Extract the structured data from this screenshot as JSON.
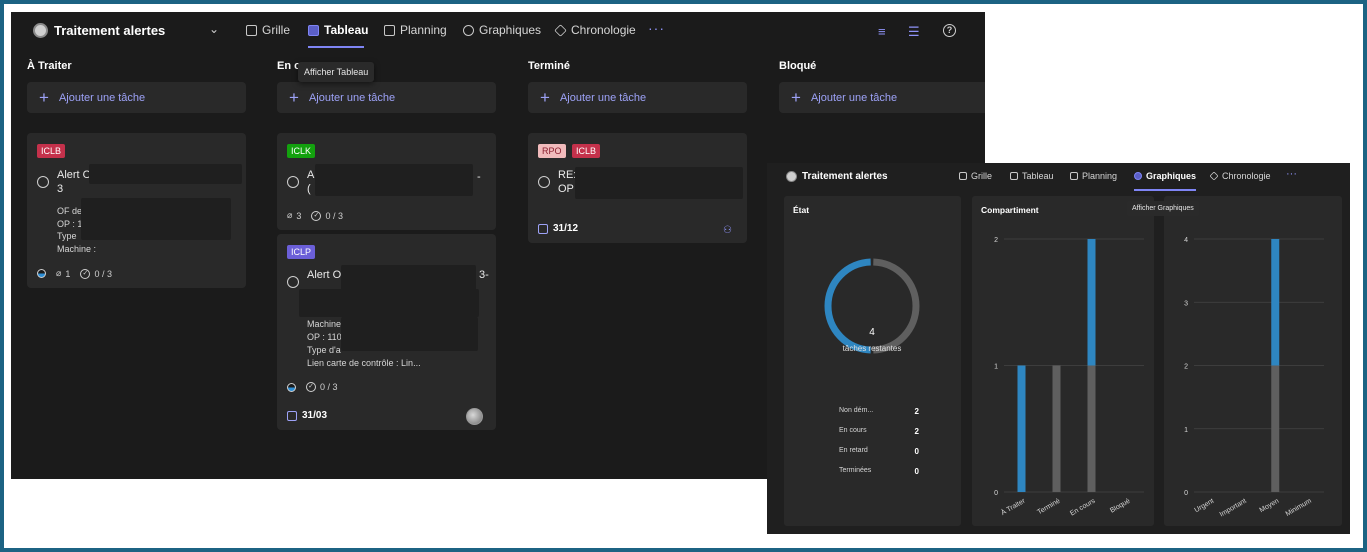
{
  "colors": {
    "accent": "#7f85f5",
    "bar_blue": "#2e86c1",
    "bar_grey": "#5f5f5f",
    "badge_red": "#c4314b",
    "badge_green": "#13a10e",
    "badge_purple": "#6b5fd8",
    "badge_pink": "#f1bbbc"
  },
  "main": {
    "plan_title": "Traitement alertes",
    "tabs": [
      {
        "label": "Grille",
        "icon": "grid-icon"
      },
      {
        "label": "Tableau",
        "icon": "board-icon"
      },
      {
        "label": "Planning",
        "icon": "calendar-icon"
      },
      {
        "label": "Graphiques",
        "icon": "chart-icon"
      },
      {
        "label": "Chronologie",
        "icon": "timeline-icon"
      }
    ],
    "more": "···",
    "tooltip": "Afficher Tableau",
    "columns": [
      {
        "title": "À Traiter",
        "add_label": "Ajouter une tâche"
      },
      {
        "title": "En c",
        "add_label": "Ajouter une tâche"
      },
      {
        "title": "Terminé",
        "add_label": "Ajouter une tâche"
      },
      {
        "title": "Bloqué",
        "add_label": "Ajouter une tâche"
      }
    ],
    "cards": {
      "c1": {
        "badge": "ICLB",
        "title_line1": "Alert O",
        "title_line2": "3",
        "desc": [
          "OF de",
          "OP : 1",
          "Type",
          "Machine :"
        ],
        "attachments": "1",
        "checklist": "0 / 3"
      },
      "c2": {
        "badge": "ICLK",
        "title_line1": "A",
        "title_line2": "(",
        "title_tail": "-",
        "attachments": "3",
        "checklist": "0 / 3"
      },
      "c3": {
        "badge": "ICLP",
        "title_line1": "Alert O",
        "title_tail": "3-",
        "desc": [
          "Machine",
          "OP : 110",
          "Type d'a",
          "Lien carte de contrôle : Lin..."
        ],
        "checklist": "0 / 3",
        "date": "31/03"
      },
      "c4": {
        "badge1": "RPO",
        "badge2": "ICLB",
        "title_line1": "RE:",
        "title_line2": "OP",
        "date": "31/12"
      }
    }
  },
  "charts_window": {
    "plan_title": "Traitement alertes",
    "tabs": [
      {
        "label": "Grille"
      },
      {
        "label": "Tableau"
      },
      {
        "label": "Planning"
      },
      {
        "label": "Graphiques"
      },
      {
        "label": "Chronologie"
      }
    ],
    "more": "···",
    "tooltip": "Afficher Graphiques",
    "etat": {
      "title": "État",
      "remaining_count": "4",
      "remaining_label": "tâches restantes",
      "rows": [
        {
          "label": "Non dém...",
          "value": "2"
        },
        {
          "label": "En cours",
          "value": "2"
        },
        {
          "label": "En retard",
          "value": "0"
        },
        {
          "label": "Terminées",
          "value": "0"
        }
      ]
    },
    "compartiment_title": "Compartiment"
  },
  "chart_data": [
    {
      "type": "pie",
      "title": "État",
      "categories": [
        "Non démarrées",
        "En cours"
      ],
      "values": [
        2,
        2
      ],
      "colors": [
        "#5f5f5f",
        "#2e86c1"
      ]
    },
    {
      "type": "bar",
      "title": "Compartiment",
      "categories": [
        "À Traiter",
        "Terminé",
        "En cours",
        "Bloqué"
      ],
      "series": [
        {
          "values": [
            0,
            1,
            1,
            0
          ],
          "color": "#5f5f5f"
        },
        {
          "values": [
            1,
            0,
            1,
            0
          ],
          "color": "#2e86c1"
        }
      ],
      "ylim": [
        0,
        2
      ],
      "yticks": [
        "0",
        "1",
        "2"
      ]
    },
    {
      "type": "bar",
      "title": "",
      "categories": [
        "Urgent",
        "Important",
        "Moyen",
        "Minimum"
      ],
      "series": [
        {
          "values": [
            0,
            0,
            2,
            0
          ],
          "color": "#5f5f5f"
        },
        {
          "values": [
            0,
            0,
            2,
            0
          ],
          "color": "#2e86c1"
        }
      ],
      "ylim": [
        0,
        4
      ],
      "yticks": [
        "0",
        "1",
        "2",
        "3",
        "4"
      ]
    }
  ]
}
